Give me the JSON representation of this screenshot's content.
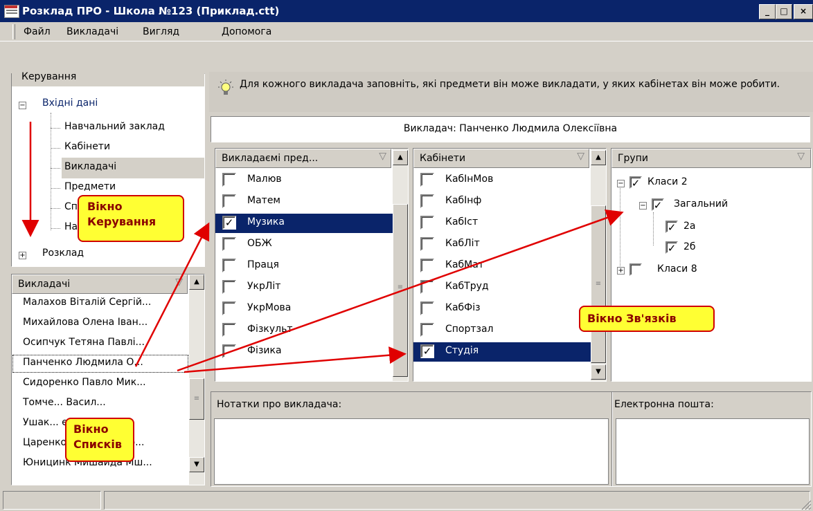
{
  "window": {
    "title": "Розклад ПРО - Школа №123 (Приклад.ctt)",
    "min": "_",
    "max": "□",
    "close": "×"
  },
  "menu": [
    "Файл",
    "Викладачі",
    "Вигляд",
    "Допомога"
  ],
  "control_panel": {
    "header": "Керування",
    "root1": {
      "label": "Вхідні дані",
      "toggle": "−"
    },
    "children": [
      "Навчальний заклад",
      "Кабінети",
      "Викладачі",
      "Предмети",
      "Сп",
      "На"
    ],
    "root2": {
      "label": "Розклад",
      "toggle": "+"
    }
  },
  "teachers_list": {
    "header": "Викладачі",
    "items": [
      "Малахов Віталій Сергій...",
      "Михайлова Олена Іван...",
      "Осипчук Тетяна Павлі...",
      "Панченко Людмила О...",
      "Сидоренко Павло Мик...",
      "Томче... Васил...",
      "Ушак... екс...",
      "Царенко Тетяна проф...",
      "Юницинк Мишайда Мш..."
    ],
    "selected_index": 3
  },
  "hint": {
    "text": "Для кожного викладача заповніть, які предмети він може викладати, у яких кабінетах він може робити."
  },
  "teacher_bar": "Викладач: Панченко Людмила Олексіївна",
  "subjects": {
    "header": "Викладаємі пред...",
    "items": [
      {
        "label": "Малюв",
        "checked": false
      },
      {
        "label": "Матем",
        "checked": false
      },
      {
        "label": "Музика",
        "checked": true
      },
      {
        "label": "ОБЖ",
        "checked": false
      },
      {
        "label": "Праця",
        "checked": false
      },
      {
        "label": "УкрЛіт",
        "checked": false
      },
      {
        "label": "УкрМова",
        "checked": false
      },
      {
        "label": "Фізкульт",
        "checked": false
      },
      {
        "label": "Фізика",
        "checked": false
      }
    ],
    "selected_index": 2
  },
  "rooms": {
    "header": "Кабінети",
    "items": [
      {
        "label": "КабІнМов",
        "checked": false
      },
      {
        "label": "КабІнф",
        "checked": false
      },
      {
        "label": "КабІст",
        "checked": false
      },
      {
        "label": "КабЛіт",
        "checked": false
      },
      {
        "label": "КабМат",
        "checked": false
      },
      {
        "label": "КабТруд",
        "checked": false
      },
      {
        "label": "КабФіз",
        "checked": false
      },
      {
        "label": "Спортзал",
        "checked": false
      },
      {
        "label": "Студія",
        "checked": true
      }
    ],
    "selected_index": 8
  },
  "groups": {
    "header": "Групи",
    "items": [
      "Класи 2",
      "Загальний",
      "2а",
      "2б",
      "Класи 8"
    ]
  },
  "notes_label": "Нотатки про викладача:",
  "email_label": "Електронна пошта:",
  "callouts": {
    "control": [
      "Вікно",
      "Керування"
    ],
    "lists": [
      "Вікно",
      "Списків"
    ],
    "links": "Вікно Зв'язків"
  },
  "check_glyph": "✓",
  "scroll": {
    "up": "▲",
    "down": "▼",
    "grip": "≡",
    "filter": "▽"
  },
  "colors": {
    "selection": "#0a246a",
    "title_bar": "#0a246a",
    "callout_fill": "#ffff33",
    "callout_border": "#d00000",
    "arrow": "#e00000"
  }
}
